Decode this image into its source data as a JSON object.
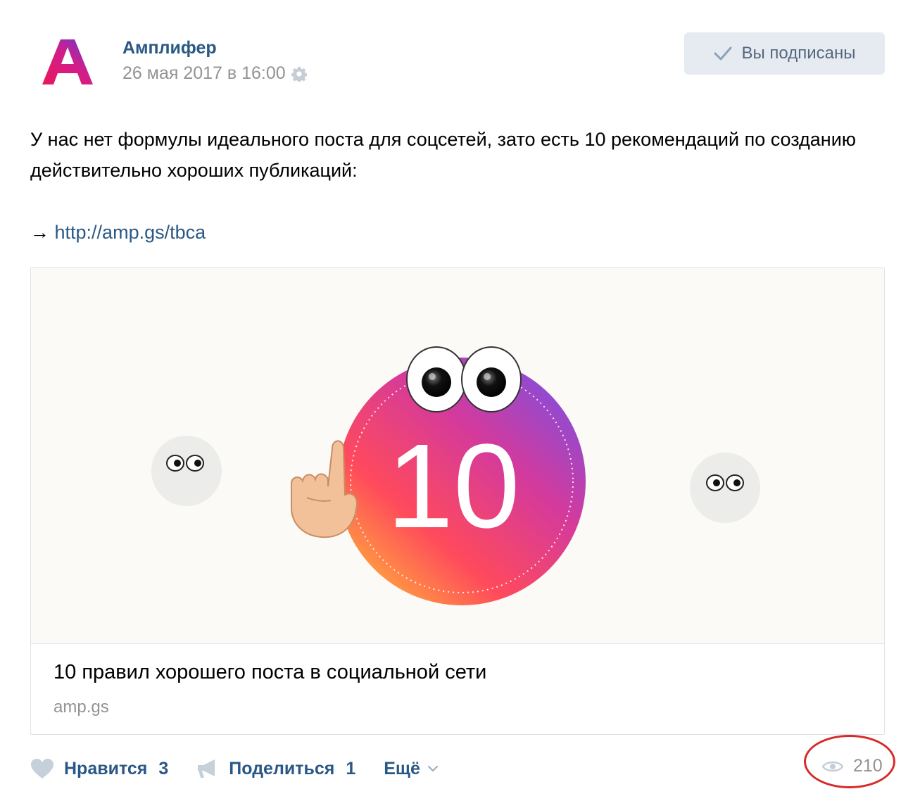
{
  "post": {
    "author": "Амплифер",
    "date": "26 мая 2017 в 16:00",
    "subscribe_label": "Вы подписаны",
    "text": "У нас нет формулы идеального поста для соцсетей, зато есть 10 рекомендаций по созданию действительно хороших публикаций:",
    "link_arrow": "→",
    "link": "http://amp.gs/tbca"
  },
  "card": {
    "image_number": "10",
    "title": "10 правил хорошего поста в социальной сети",
    "domain": "amp.gs"
  },
  "actions": {
    "like_label": "Нравится",
    "like_count": "3",
    "share_label": "Поделиться",
    "share_count": "1",
    "more_label": "Ещё",
    "views": "210"
  },
  "icons": [
    "avatar-logo",
    "gear-icon",
    "check-icon",
    "heart-icon",
    "megaphone-icon",
    "chevron-down-icon",
    "eye-icon"
  ],
  "colors": {
    "link": "#2a5885",
    "button_bg": "#e5ebf1",
    "muted": "#939393",
    "highlight_ring": "#d82a2a"
  }
}
